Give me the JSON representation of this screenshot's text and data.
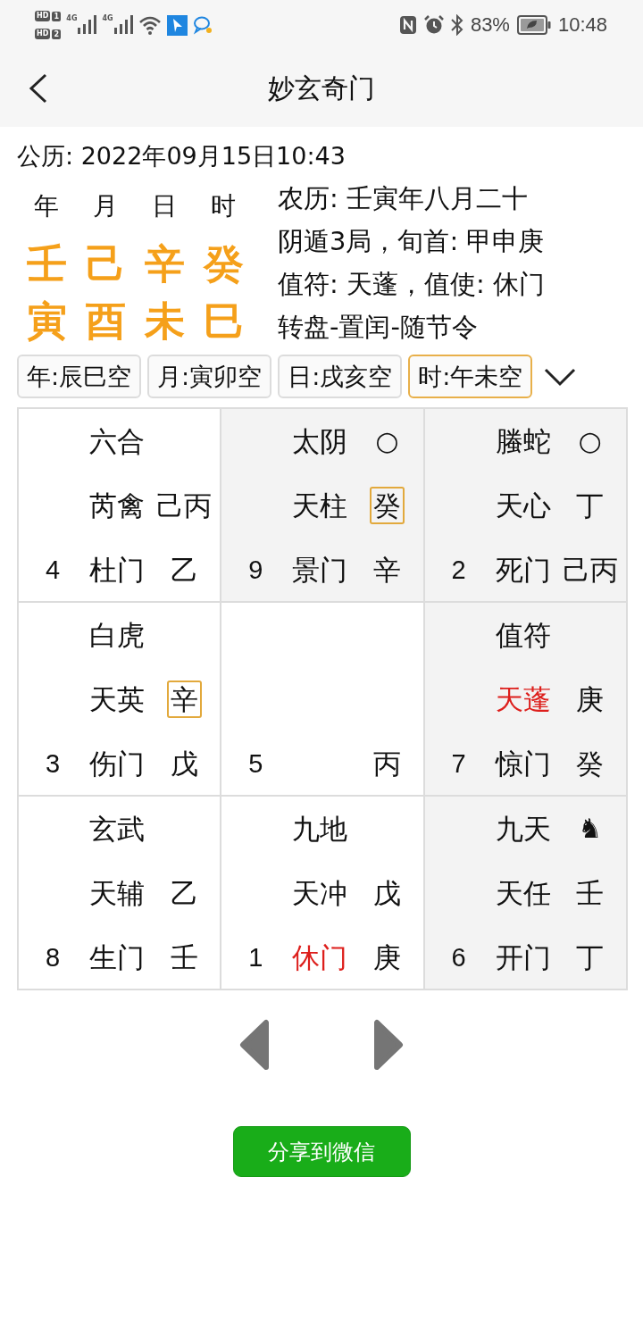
{
  "status_bar": {
    "sims": [
      {
        "badge": "HD",
        "slot": "1",
        "network": "4G"
      },
      {
        "badge": "HD",
        "slot": "2",
        "network": "4G"
      }
    ],
    "battery": "83%",
    "time": "10:48"
  },
  "header": {
    "title": "妙玄奇门"
  },
  "solar_date": "公历: 2022年09月15日10:43",
  "pillars": [
    {
      "label": "年",
      "stem": "壬",
      "branch": "寅"
    },
    {
      "label": "月",
      "stem": "己",
      "branch": "酉"
    },
    {
      "label": "日",
      "stem": "辛",
      "branch": "未"
    },
    {
      "label": "时",
      "stem": "癸",
      "branch": "巳"
    }
  ],
  "info_lines": [
    "农历: 壬寅年八月二十",
    "阴遁3局，旬首: 甲申庚",
    "值符: 天蓬，值使: 休门",
    "转盘-置闰-随节令"
  ],
  "void_chips": [
    {
      "label": "年:辰巳空",
      "selected": false
    },
    {
      "label": "月:寅卯空",
      "selected": false
    },
    {
      "label": "日:戌亥空",
      "selected": false
    },
    {
      "label": "时:午未空",
      "selected": true
    }
  ],
  "palace_rows": [
    [
      {
        "shaded": false,
        "deity": "六合",
        "star": {
          "name": "芮禽",
          "highlighted": false
        },
        "star_stem": {
          "text": "己丙",
          "boxed": false
        },
        "number": "4",
        "gate": {
          "name": "杜门",
          "highlighted": false
        },
        "gate_stem": "乙"
      },
      {
        "shaded": true,
        "deity": "太阴",
        "marker": "○",
        "star": {
          "name": "天柱",
          "highlighted": false
        },
        "star_stem": {
          "text": "癸",
          "boxed": true
        },
        "number": "9",
        "gate": {
          "name": "景门",
          "highlighted": false
        },
        "gate_stem": "辛"
      },
      {
        "shaded": true,
        "deity": "螣蛇",
        "marker": "○",
        "star": {
          "name": "天心",
          "highlighted": false
        },
        "star_stem": {
          "text": "丁",
          "boxed": false
        },
        "number": "2",
        "gate": {
          "name": "死门",
          "highlighted": false
        },
        "gate_stem": "己丙"
      }
    ],
    [
      {
        "shaded": false,
        "deity": "白虎",
        "star": {
          "name": "天英",
          "highlighted": false
        },
        "star_stem": {
          "text": "辛",
          "boxed": true
        },
        "number": "3",
        "gate": {
          "name": "伤门",
          "highlighted": false
        },
        "gate_stem": "戊"
      },
      {
        "shaded": false,
        "number": "5",
        "gate_stem": "丙"
      },
      {
        "shaded": true,
        "deity": "值符",
        "star": {
          "name": "天蓬",
          "highlighted": true
        },
        "star_stem": {
          "text": "庚",
          "boxed": false
        },
        "number": "7",
        "gate": {
          "name": "惊门",
          "highlighted": false
        },
        "gate_stem": "癸"
      }
    ],
    [
      {
        "shaded": false,
        "deity": "玄武",
        "star": {
          "name": "天辅",
          "highlighted": false
        },
        "star_stem": {
          "text": "乙",
          "boxed": false
        },
        "number": "8",
        "gate": {
          "name": "生门",
          "highlighted": false
        },
        "gate_stem": "壬"
      },
      {
        "shaded": false,
        "deity": "九地",
        "star": {
          "name": "天冲",
          "highlighted": false
        },
        "star_stem": {
          "text": "戊",
          "boxed": false
        },
        "number": "1",
        "gate": {
          "name": "休门",
          "highlighted": true
        },
        "gate_stem": "庚"
      },
      {
        "shaded": true,
        "deity": "九天",
        "marker": "♞",
        "star": {
          "name": "天任",
          "highlighted": false
        },
        "star_stem": {
          "text": "壬",
          "boxed": false
        },
        "number": "6",
        "gate": {
          "name": "开门",
          "highlighted": false
        },
        "gate_stem": "丁"
      }
    ]
  ],
  "share_button": "分享到微信"
}
